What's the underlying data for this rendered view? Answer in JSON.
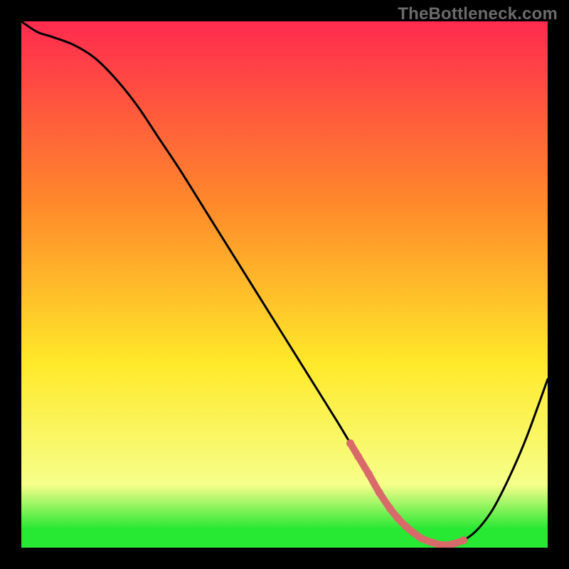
{
  "watermark": "TheBottleneck.com",
  "colors": {
    "background": "#000000",
    "curve": "#000000",
    "highlight": "#d96a6a",
    "gradient_top": "#ff2a4f",
    "gradient_mid1": "#ff8a2a",
    "gradient_mid2": "#ffe92a",
    "gradient_mid3": "#f6ff8a",
    "gradient_bottom": "#27e833"
  },
  "chart_data": {
    "type": "line",
    "title": "",
    "xlabel": "",
    "ylabel": "",
    "xlim": [
      0,
      100
    ],
    "ylim": [
      0,
      100
    ],
    "x": [
      0,
      3,
      6,
      10,
      14,
      18,
      22,
      26,
      30,
      35,
      40,
      45,
      50,
      55,
      60,
      63,
      66,
      68,
      70,
      72,
      74,
      76,
      78,
      80,
      82,
      84,
      86,
      88,
      90,
      93,
      96,
      100
    ],
    "values": [
      100,
      98,
      97,
      95.5,
      93,
      89,
      84,
      78,
      72,
      64,
      56,
      48,
      40,
      32,
      24,
      19,
      14,
      10.5,
      7.5,
      5,
      3.2,
      1.8,
      1.0,
      0.5,
      0.7,
      1.4,
      2.8,
      5,
      8,
      14,
      21,
      32
    ],
    "highlight_range_x": [
      62.5,
      84
    ],
    "highlight_points_x": [
      62.5,
      64,
      66,
      68,
      70,
      71.5,
      73,
      74.5,
      76,
      78,
      80,
      82,
      84
    ]
  }
}
